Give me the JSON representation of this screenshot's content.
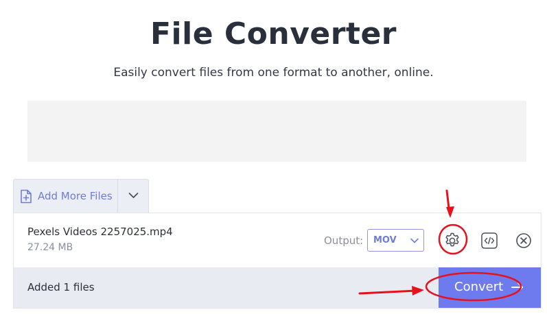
{
  "header": {
    "title": "File Converter",
    "subtitle": "Easily convert files from one format to another, online."
  },
  "add_files": {
    "label": "Add More Files",
    "icon": "file-plus-icon",
    "dropdown_icon": "chevron-down-icon"
  },
  "file": {
    "name": "Pexels Videos 2257025.mp4",
    "size": "27.24 MB",
    "output_label": "Output:",
    "output_value": "MOV",
    "actions": [
      "gear-icon",
      "code-icon",
      "close-circle-icon"
    ]
  },
  "footer": {
    "added_text": "Added 1 files",
    "convert_label": "Convert",
    "convert_icon": "arrow-right-icon"
  },
  "colors": {
    "accent": "#6e7bee",
    "annotation": "#e8101a",
    "panel_bg": "#e9ebf3"
  }
}
